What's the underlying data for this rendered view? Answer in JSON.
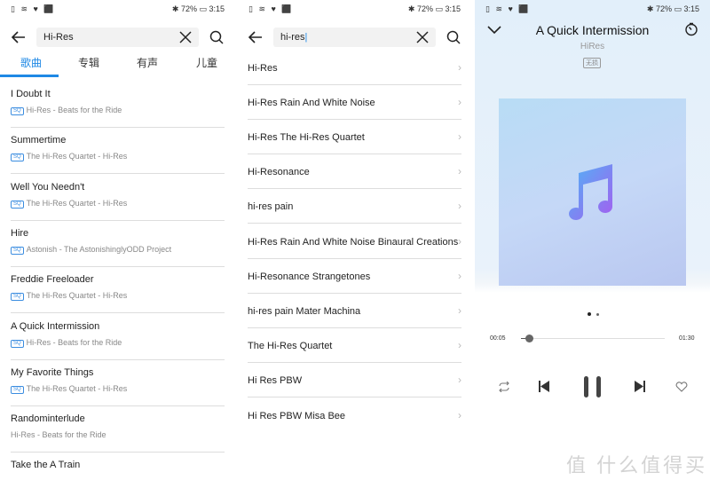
{
  "status_bar": {
    "left_icons": "▯ ≋ ♥ ⬛",
    "battery": "72%",
    "time": "3:15"
  },
  "search_results": {
    "query": "Hi-Res",
    "tabs": [
      {
        "label": "歌曲",
        "active": true
      },
      {
        "label": "专辑"
      },
      {
        "label": "有声"
      },
      {
        "label": "儿童"
      }
    ],
    "accent_color": "#1e88e5",
    "badge": "SQ",
    "songs": [
      {
        "title": "I Doubt It",
        "subtitle": "Hi-Res - Beats for the Ride",
        "sq": true
      },
      {
        "title": "Summertime",
        "subtitle": "The Hi-Res Quartet - Hi-Res",
        "sq": true
      },
      {
        "title": "Well You Needn't",
        "subtitle": "The Hi-Res Quartet - Hi-Res",
        "sq": true
      },
      {
        "title": "Hire",
        "subtitle": "Astonish - The AstonishinglyODD Project",
        "sq": true
      },
      {
        "title": "Freddie Freeloader",
        "subtitle": "The Hi-Res Quartet - Hi-Res",
        "sq": true
      },
      {
        "title": "A Quick Intermission",
        "subtitle": "Hi-Res - Beats for the Ride",
        "sq": true
      },
      {
        "title": "My Favorite Things",
        "subtitle": "The Hi-Res Quartet - Hi-Res",
        "sq": true
      },
      {
        "title": "Randominterlude",
        "subtitle": "Hi-Res - Beats for the Ride",
        "sq": false
      },
      {
        "title": "Take the  A  Train",
        "subtitle": "",
        "sq": false
      }
    ]
  },
  "suggestions": {
    "query": "hi-res",
    "items": [
      "Hi-Res",
      "Hi-Res Rain And White Noise",
      "Hi-Res The Hi-Res Quartet",
      "Hi-Resonance",
      "hi-res pain",
      "Hi-Res Rain And White Noise Binaural Creations",
      "Hi-Resonance Strangetones",
      "hi-res pain Mater Machina",
      "The Hi-Res Quartet",
      "Hi Res PBW",
      "Hi Res PBW Misa Bee"
    ]
  },
  "player": {
    "title": "A Quick Intermission",
    "artist": "HiRes",
    "quality_badge": "无损",
    "elapsed": "00:05",
    "duration": "01:30",
    "progress_fraction": 0.055,
    "page_dots": 2,
    "page_active": 0
  },
  "watermark": {
    "text": "值 什么值得买"
  }
}
